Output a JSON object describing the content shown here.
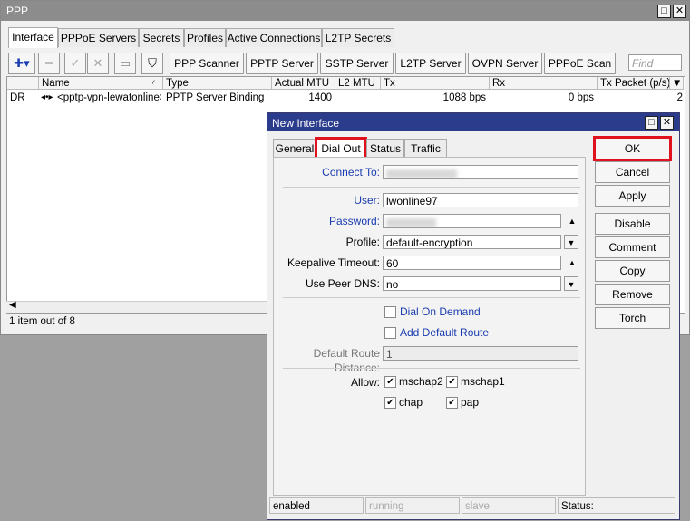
{
  "window": {
    "title": "PPP"
  },
  "tabs": [
    "Interface",
    "PPPoE Servers",
    "Secrets",
    "Profiles",
    "Active Connections",
    "L2TP Secrets"
  ],
  "toolbar": {
    "buttons": [
      "PPP Scanner",
      "PPTP Server",
      "SSTP Server",
      "L2TP Server",
      "OVPN Server",
      "PPPoE Scan"
    ],
    "find_placeholder": "Find"
  },
  "table": {
    "columns": [
      "Name",
      "Type",
      "Actual MTU",
      "L2 MTU",
      "Tx",
      "Rx",
      "Tx Packet (p/s)"
    ],
    "rows": [
      {
        "flag": "DR",
        "name": "<pptp-vpn-lewatonline>",
        "type": "PPTP Server Binding",
        "actual_mtu": "1400",
        "l2_mtu": "",
        "tx": "1088 bps",
        "rx": "0 bps",
        "tx_packet": "2"
      }
    ]
  },
  "status": {
    "items_count": "1 item out of 8"
  },
  "dialog": {
    "title": "New Interface",
    "tabs": [
      "General",
      "Dial Out",
      "Status",
      "Traffic"
    ],
    "active_tab": "Dial Out",
    "fields": {
      "connect_to": {
        "label": "Connect To:",
        "value": ""
      },
      "user": {
        "label": "User:",
        "value": "lwonline97"
      },
      "password": {
        "label": "Password:",
        "value": ""
      },
      "profile": {
        "label": "Profile:",
        "value": "default-encryption"
      },
      "keepalive": {
        "label": "Keepalive Timeout:",
        "value": "60"
      },
      "peer_dns": {
        "label": "Use Peer DNS:",
        "value": "no"
      },
      "route_distance": {
        "label": "Default Route Distance:",
        "value": "1"
      }
    },
    "checkboxes": {
      "dial_on_demand": {
        "label": "Dial On Demand",
        "checked": false
      },
      "add_default_route": {
        "label": "Add Default Route",
        "checked": false
      }
    },
    "allow": {
      "label": "Allow:",
      "options": [
        {
          "label": "mschap2",
          "checked": true
        },
        {
          "label": "mschap1",
          "checked": true
        },
        {
          "label": "chap",
          "checked": true
        },
        {
          "label": "pap",
          "checked": true
        }
      ]
    },
    "buttons": [
      "OK",
      "Cancel",
      "Apply",
      "Disable",
      "Comment",
      "Copy",
      "Remove",
      "Torch"
    ],
    "statusbar": [
      "enabled",
      "running",
      "slave",
      "Status:"
    ]
  },
  "colors": {
    "highlight": "#e0121e",
    "dialog_title": "#2c3c8c",
    "link_label": "#1a3cb0"
  }
}
